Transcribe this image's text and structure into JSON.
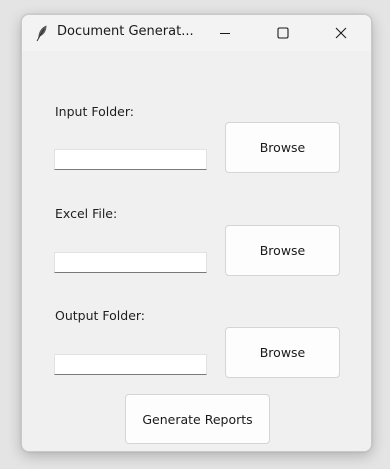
{
  "window": {
    "title": "Document Generat...",
    "icon": "feather-icon"
  },
  "controls": {
    "minimize_icon": "minimize-icon",
    "maximize_icon": "maximize-icon",
    "close_icon": "close-icon"
  },
  "form": {
    "input_folder": {
      "label": "Input Folder:",
      "value": "",
      "browse_label": "Browse"
    },
    "excel_file": {
      "label": "Excel File:",
      "value": "",
      "browse_label": "Browse"
    },
    "output_folder": {
      "label": "Output Folder:",
      "value": "",
      "browse_label": "Browse"
    }
  },
  "actions": {
    "generate_label": "Generate Reports"
  }
}
